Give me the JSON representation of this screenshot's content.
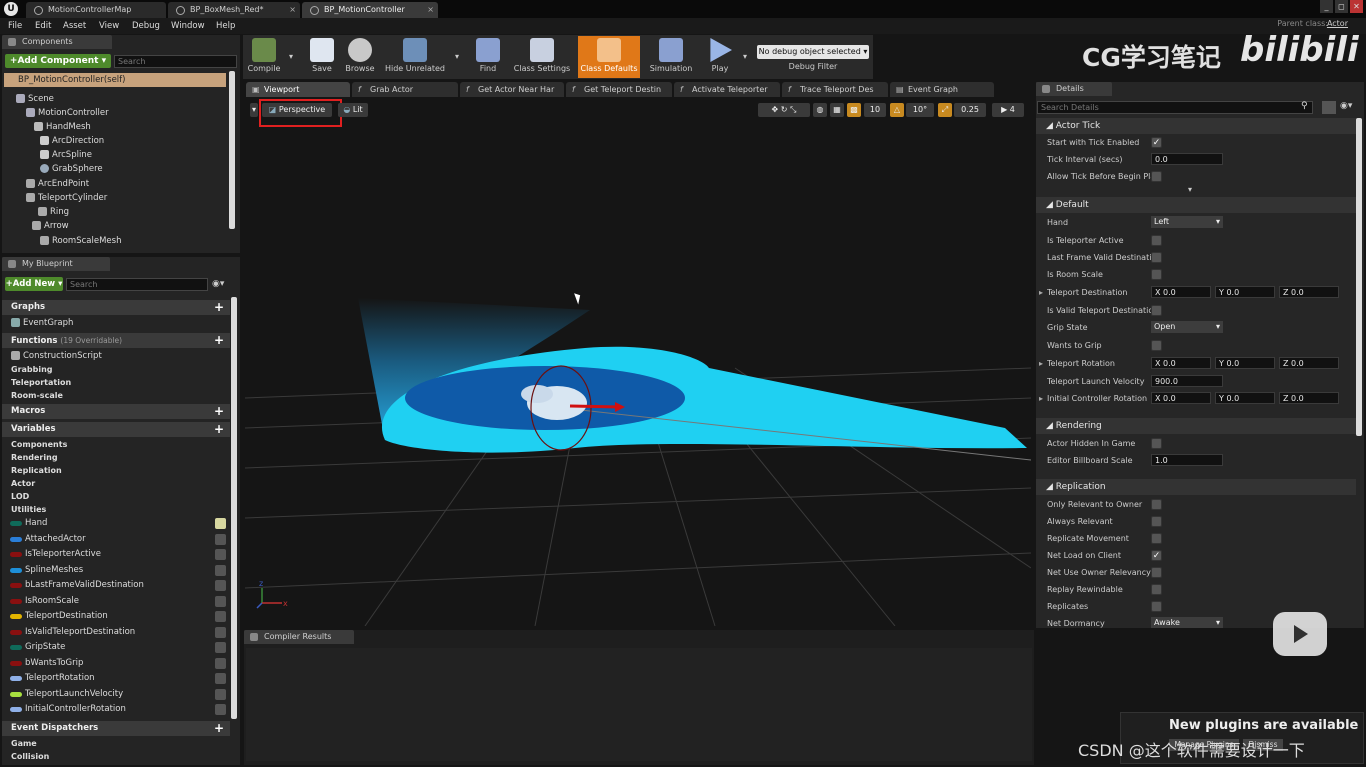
{
  "titlebar": {
    "tabs": [
      "MotionControllerMap",
      "BP_BoxMesh_Red*",
      "BP_MotionController"
    ],
    "window_buttons": [
      "_",
      "◻",
      "✕"
    ]
  },
  "menubar": {
    "items": [
      "File",
      "Edit",
      "Asset",
      "View",
      "Debug",
      "Window",
      "Help"
    ],
    "parent_class_label": "Parent class:",
    "parent_class_value": "Actor"
  },
  "components": {
    "tab": "Components",
    "add_button": "+Add Component ▾",
    "search_placeholder": "Search",
    "self": "BP_MotionController(self)",
    "tree": [
      "Scene",
      "MotionController",
      "HandMesh",
      "ArcDirection",
      "ArcSpline",
      "GrabSphere",
      "ArcEndPoint",
      "TeleportCylinder",
      "Ring",
      "Arrow",
      "RoomScaleMesh"
    ]
  },
  "myblueprint": {
    "tab": "My Blueprint",
    "add_button": "+Add New ▾",
    "search_placeholder": "Search",
    "graphs_header": "Graphs",
    "graphs": [
      "EventGraph"
    ],
    "functions_header": "Functions",
    "functions_note": "(19 Overridable)",
    "functions": [
      "ConstructionScript"
    ],
    "function_categories": [
      "Grabbing",
      "Teleportation",
      "Room-scale"
    ],
    "macros_header": "Macros",
    "variables_header": "Variables",
    "variable_categories": [
      "Components",
      "Rendering",
      "Replication",
      "Actor",
      "LOD",
      "Utilities"
    ],
    "variables": [
      {
        "name": "Hand",
        "color": "#0f6b5a"
      },
      {
        "name": "AttachedActor",
        "color": "#2a7ed8"
      },
      {
        "name": "IsTeleporterActive",
        "color": "#8a1010"
      },
      {
        "name": "SplineMeshes",
        "color": "#1e8fd8"
      },
      {
        "name": "bLastFrameValidDestination",
        "color": "#8a1010"
      },
      {
        "name": "IsRoomScale",
        "color": "#8a1010"
      },
      {
        "name": "TeleportDestination",
        "color": "#e3b400"
      },
      {
        "name": "IsValidTeleportDestination",
        "color": "#8a1010"
      },
      {
        "name": "GripState",
        "color": "#0f6b5a"
      },
      {
        "name": "bWantsToGrip",
        "color": "#8a1010"
      },
      {
        "name": "TeleportRotation",
        "color": "#8fb0e8"
      },
      {
        "name": "TeleportLaunchVelocity",
        "color": "#a8e040"
      },
      {
        "name": "InitialControllerRotation",
        "color": "#8fb0e8"
      }
    ],
    "dispatchers_header": "Event Dispatchers",
    "dispatcher_categories": [
      "Game",
      "Collision"
    ]
  },
  "toolbar": {
    "buttons": [
      "Compile",
      "Save",
      "Browse",
      "Hide Unrelated",
      "Find",
      "Class Settings",
      "Class Defaults",
      "Simulation",
      "Play"
    ],
    "debug_select": "No debug object selected ▾",
    "debug_label": "Debug Filter"
  },
  "watermark": {
    "text": "CG学习笔记",
    "logo": "bilibili"
  },
  "graph_tabs": [
    "Viewport",
    "Grab Actor",
    "Get Actor Near Har",
    "Get Teleport Destin",
    "Activate Teleporter",
    "Trace Teleport Des",
    "Event Graph"
  ],
  "viewport": {
    "perspective": "Perspective",
    "lit": "Lit",
    "grid_snap": "10",
    "rot_snap": "10°",
    "scale_snap": "0.25",
    "cam_speed": "4",
    "axis_x": "x",
    "axis_z": "z"
  },
  "compiler": {
    "tab": "Compiler Results"
  },
  "details": {
    "tab": "Details",
    "search_placeholder": "Search Details",
    "actor_tick": {
      "header": "Actor Tick",
      "start_tick": "Start with Tick Enabled",
      "tick_interval": "Tick Interval (secs)",
      "tick_interval_val": "0.0",
      "allow_tick": "Allow Tick Before Begin Play"
    },
    "default": {
      "header": "Default",
      "hand": "Hand",
      "hand_val": "Left",
      "teleporter_active": "Is Teleporter Active",
      "last_frame": "Last Frame Valid Destination",
      "room_scale": "Is Room Scale",
      "teleport_dest": "Teleport Destination",
      "valid_dest": "Is Valid Teleport Destination",
      "grip_state": "Grip State",
      "grip_val": "Open",
      "wants_grip": "Wants to Grip",
      "teleport_rot": "Teleport Rotation",
      "launch_vel": "Teleport Launch Velocity",
      "launch_val": "900.0",
      "init_rot": "Initial Controller Rotation",
      "x": "X",
      "y": "Y",
      "z": "Z",
      "zero": "0.0"
    },
    "rendering": {
      "header": "Rendering",
      "hidden": "Actor Hidden In Game",
      "billboard": "Editor Billboard Scale",
      "billboard_val": "1.0"
    },
    "replication": {
      "header": "Replication",
      "rows": [
        "Only Relevant to Owner",
        "Always Relevant",
        "Replicate Movement",
        "Net Load on Client",
        "Net Use Owner Relevancy",
        "Replay Rewindable",
        "Replicates"
      ],
      "dormancy": "Net Dormancy",
      "dormancy_val": "Awake"
    }
  },
  "notification": {
    "title": "New plugins are available",
    "btn1": "Manage Plugins",
    "btn2": "Dismiss"
  },
  "footer_watermark": "CSDN @这个软件需要设计一下"
}
